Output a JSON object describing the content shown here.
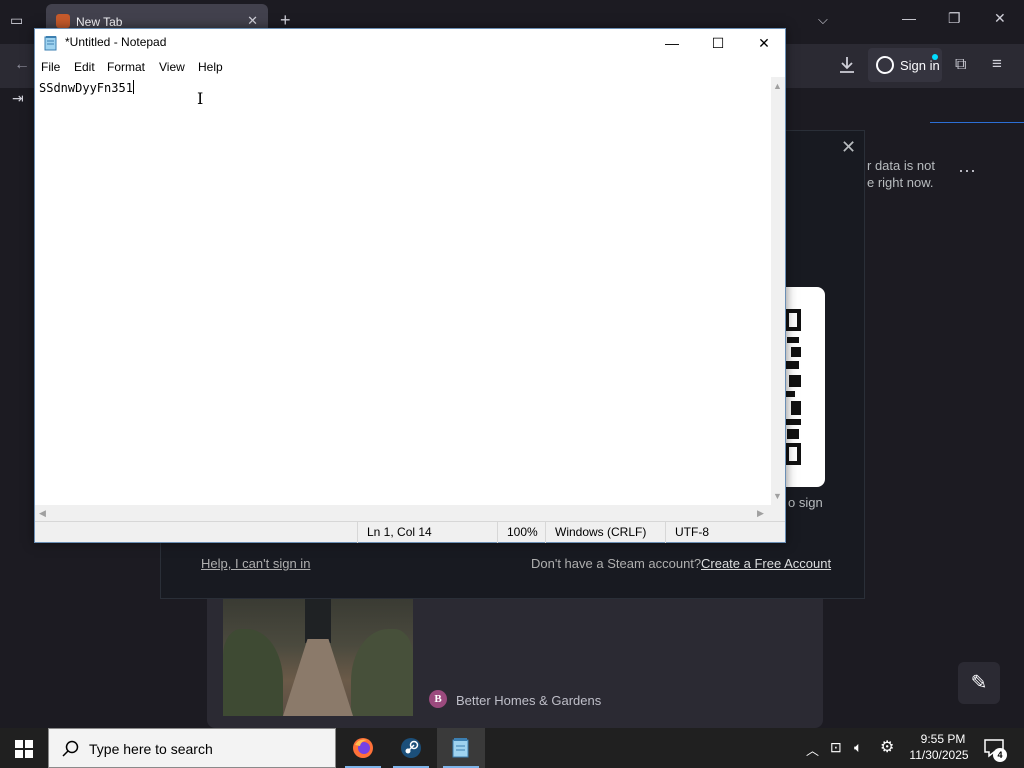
{
  "browser": {
    "tab_title": "New Tab",
    "tab_close_icon": "✕",
    "new_tab_icon": "+",
    "signin_label": "Sign in",
    "steam": {
      "notice": "r data is not\ne right now.",
      "qr_caption": "o sign",
      "help_link": "Help, I can't sign in",
      "no_account": "Don't have a Steam account?",
      "create_link": "Create a Free Account"
    },
    "news": {
      "source_initial": "B",
      "source": "Better Homes & Gardens"
    }
  },
  "notepad": {
    "title": "*Untitled - Notepad",
    "menu": [
      "File",
      "Edit",
      "Format",
      "View",
      "Help"
    ],
    "content": "SSdnwDyyFn351",
    "status": {
      "position": "Ln 1, Col 14",
      "zoom": "100%",
      "line_ending": "Windows (CRLF)",
      "encoding": "UTF-8"
    }
  },
  "taskbar": {
    "search_placeholder": "Type here to search",
    "time": "9:55 PM",
    "date": "11/30/2025",
    "notification_count": "4",
    "apps": [
      "firefox-icon",
      "steam-icon",
      "notepad-icon"
    ]
  },
  "colors": {
    "browser_bg": "#1c1b22",
    "steam_bg": "#181a21",
    "taskbar_bg": "#202020",
    "accent": "#7eb4ea"
  }
}
